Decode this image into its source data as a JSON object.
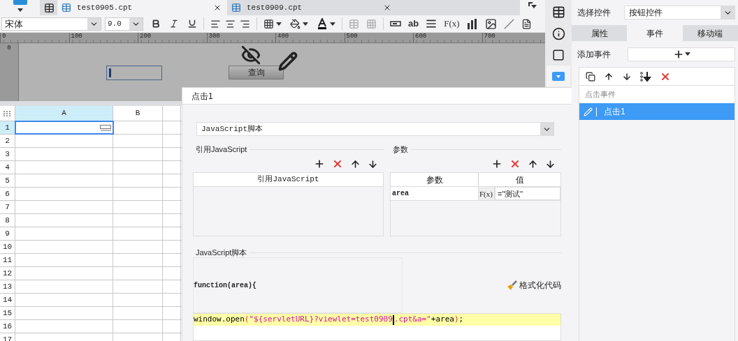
{
  "app_tabs": [
    {
      "label": "test0905.cpt",
      "selected": true
    },
    {
      "label": "test0909.cpt",
      "selected": false
    }
  ],
  "toolbar": {
    "font": "宋体",
    "size": "9.0",
    "text_icons": [
      "ab",
      "F(x)"
    ]
  },
  "ruler": {
    "marks": [
      "0",
      "100",
      "200",
      "300",
      "400",
      "500",
      "600",
      "700"
    ],
    "vertical_mark": "0"
  },
  "designer": {
    "button_label": "查询"
  },
  "grid": {
    "columns": [
      {
        "label": "A",
        "selected": true
      },
      {
        "label": "B",
        "selected": false
      }
    ],
    "rows": [
      {
        "label": "1",
        "selected": true
      },
      {
        "label": "2",
        "selected": false
      },
      {
        "label": "3",
        "selected": false
      },
      {
        "label": "4",
        "selected": false
      },
      {
        "label": "5",
        "selected": false
      },
      {
        "label": "6",
        "selected": false
      },
      {
        "label": "7",
        "selected": false
      },
      {
        "label": "8",
        "selected": false
      },
      {
        "label": "9",
        "selected": false
      },
      {
        "label": "10",
        "selected": false
      },
      {
        "label": "11",
        "selected": false
      },
      {
        "label": "12",
        "selected": false
      },
      {
        "label": "13",
        "selected": false
      },
      {
        "label": "14",
        "selected": false
      },
      {
        "label": "15",
        "selected": false
      },
      {
        "label": "16",
        "selected": false
      },
      {
        "label": "17",
        "selected": false
      }
    ]
  },
  "dialog": {
    "title": "点击1",
    "type_select": "JavaScript脚本",
    "ref_section": {
      "title": "引用JavaScript",
      "column": "引用JavaScript"
    },
    "params_section": {
      "title": "参数",
      "columns": [
        "参数",
        "值"
      ],
      "rows": [
        {
          "name": "area",
          "formula_icon": "F(x)",
          "value": "=\"测试\""
        }
      ]
    },
    "script_section": {
      "title": "JavaScript脚本",
      "header_line": "function(area){",
      "format_button": "格式化代码",
      "code_tokens": [
        {
          "kind": "plain",
          "text": "window.open"
        },
        {
          "kind": "paren",
          "text": "("
        },
        {
          "kind": "string",
          "text": "\"${servletURL}?viewlet=test0909"
        },
        {
          "kind": "cursor"
        },
        {
          "kind": "string",
          "text": ".cpt&a=\""
        },
        {
          "kind": "plain",
          "text": "+area"
        },
        {
          "kind": "paren",
          "text": ")"
        },
        {
          "kind": "plain",
          "text": ";"
        }
      ]
    }
  },
  "right_panel": {
    "select_label": "选择控件",
    "select_value": "按钮控件",
    "tabs": [
      {
        "label": "属性",
        "selected": false
      },
      {
        "label": "事件",
        "selected": true
      },
      {
        "label": "移动端",
        "selected": false
      }
    ],
    "add_event_label": "添加事件",
    "events_header": "点击事件",
    "events": [
      {
        "label": "点击1",
        "selected": true
      }
    ]
  }
}
